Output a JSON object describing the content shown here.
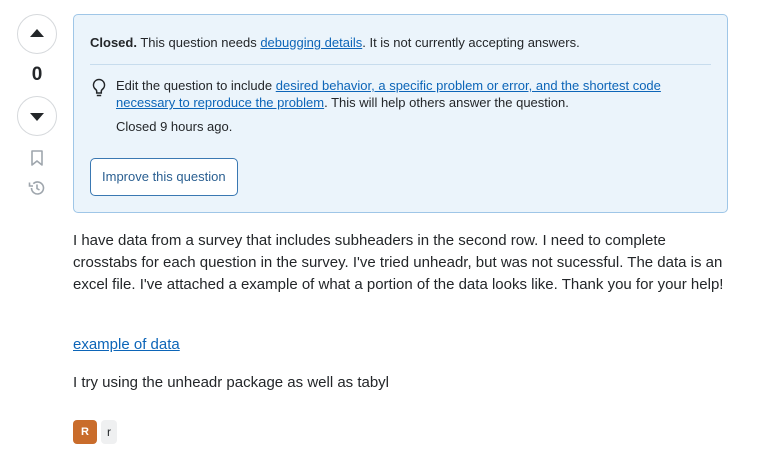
{
  "vote": {
    "count": "0"
  },
  "notice": {
    "status": "Closed.",
    "reason_prefix": " This question needs ",
    "reason_link": "debugging details",
    "reason_suffix": ". It is not currently accepting answers.",
    "body_prefix": "Edit the question to include ",
    "body_link": "desired behavior, a specific problem or error, and the shortest code necessary to reproduce the problem",
    "body_suffix": ". This will help others answer the question.",
    "closed_time": "Closed 9 hours ago.",
    "improve_button": "Improve this question"
  },
  "post": {
    "paragraph1": "I have data from a survey that includes subheaders in the second row. I need to complete crosstabs for each question in the survey. I've tried unheadr, but was not sucessful. The data is an excel file. I've attached a example of what a portion of the data looks like. Thank you for your help!",
    "link_text": "example of data",
    "paragraph3": "I try using the unheadr package as well as tabyl"
  },
  "tags": {
    "logo_letter": "R",
    "tag_r": "r"
  },
  "colors": {
    "accent": "#0c65b8",
    "notice_bg": "#ebf4fb",
    "notice_border": "#9fc6e7",
    "r_tag": "#c96c2b"
  },
  "icons": [
    "arrow-up-icon",
    "arrow-down-icon",
    "bookmark-icon",
    "history-icon",
    "lightbulb-icon"
  ]
}
